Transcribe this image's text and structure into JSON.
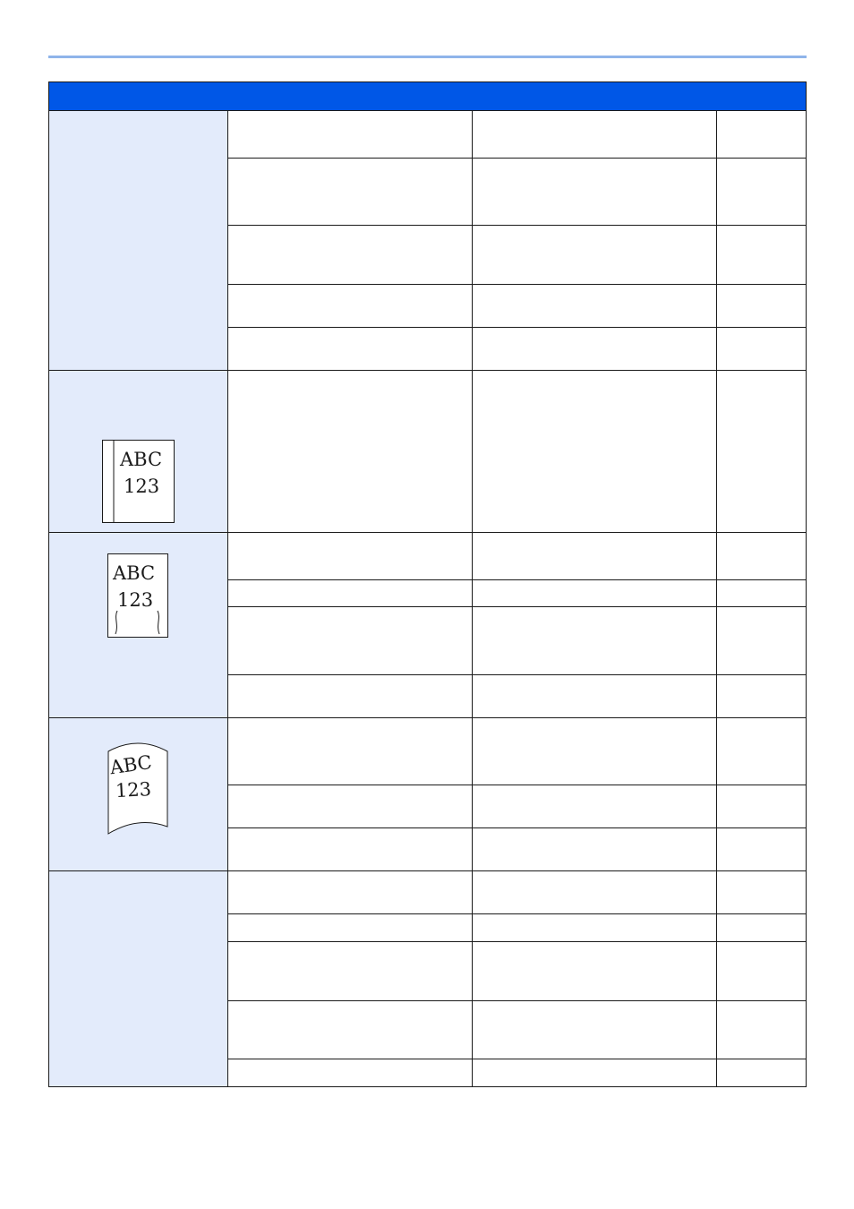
{
  "table": {
    "header": [
      "",
      "",
      "",
      ""
    ],
    "figures": {
      "fig1": {
        "line1": "ABC",
        "line2": "123"
      },
      "fig2": {
        "line1": "ABC",
        "line2": "123"
      },
      "fig3": {
        "line1": "ABC",
        "line2": "123"
      }
    }
  },
  "colors": {
    "header": "#0057e7",
    "symptom_column": "#e3ebfb",
    "top_rule": "#8fb4ea",
    "border": "#1a1a1a"
  },
  "icons": [
    "faded-left-edge-page-icon",
    "wavy-edge-page-icon",
    "curled-page-icon"
  ]
}
